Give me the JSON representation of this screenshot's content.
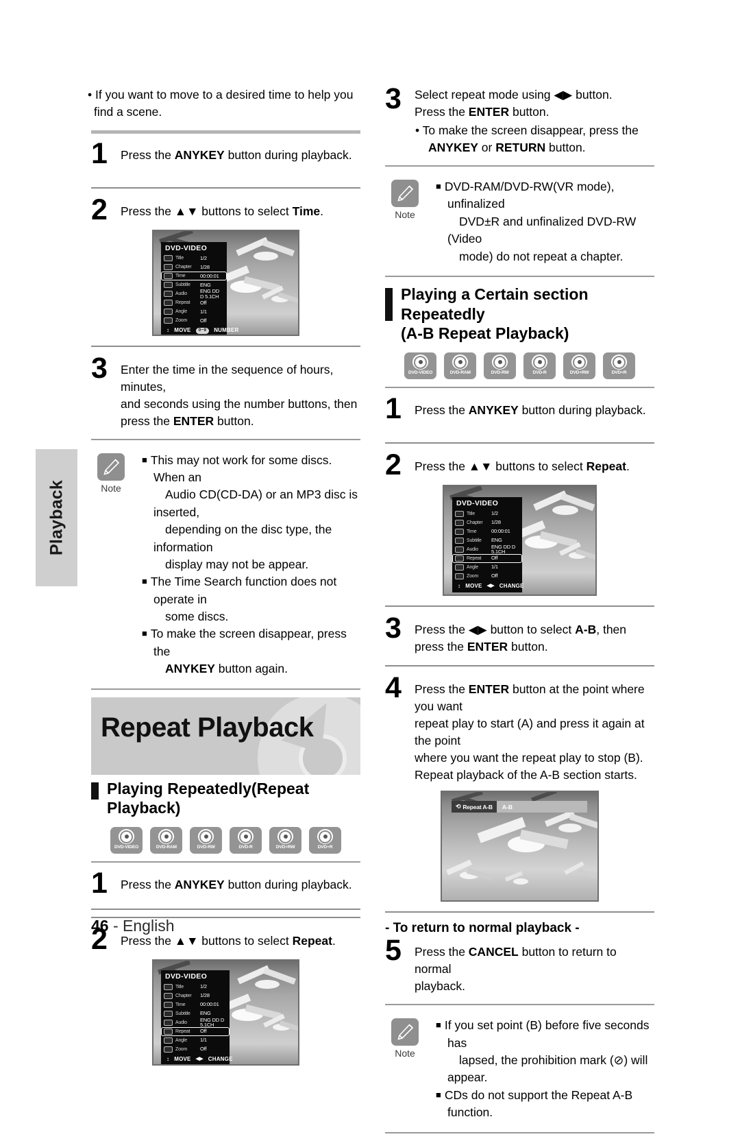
{
  "page": {
    "side_tab_label": "Playback",
    "footer_page_number": "46",
    "footer_separator": " - ",
    "footer_language": "English"
  },
  "icons": {
    "note_label": "Note",
    "note_icon": "pencil-icon",
    "disc_icon": "disc-icon",
    "repeat_icon": "repeat-icon"
  },
  "disc_badges": [
    {
      "label": "DVD-VIDEO"
    },
    {
      "label": "DVD-RAM"
    },
    {
      "label": "DVD-RW"
    },
    {
      "label": "DVD-R"
    },
    {
      "label": "DVD+RW"
    },
    {
      "label": "DVD+R"
    }
  ],
  "left_column": {
    "intro_bullet": "• If you want to move to a desired time to help you find a scene.",
    "time_search": {
      "step1_num": "1",
      "step1_text_pre": "Press the ",
      "step1_bold": "ANYKEY",
      "step1_text_post": " button during playback.",
      "step2_num": "2",
      "step2_text_pre": "Press the ▲▼ buttons to select ",
      "step2_bold": "Time",
      "step2_text_post": ".",
      "step3_num": "3",
      "step3_line1": "Enter the time in the sequence of hours, minutes,",
      "step3_line2": "and seconds using the number buttons, then",
      "step3_line3_pre": "press the ",
      "step3_bold": "ENTER",
      "step3_line3_post": " button."
    },
    "note_time_search": {
      "item1_line1": "This may not work for some discs. When an",
      "item1_line2": "Audio CD(CD-DA) or an MP3 disc is inserted,",
      "item1_line3": "depending on the disc type, the information",
      "item1_line4": "display may not be appear.",
      "item2_line1": "The Time Search function does not operate in",
      "item2_line2": "some discs.",
      "item3_line1": "To make the screen disappear, press the",
      "item3_bold": "ANYKEY",
      "item3_line2_post": " button again."
    },
    "banner_title": "Repeat Playback",
    "section_title": "Playing Repeatedly(Repeat Playback)",
    "repeat_playback": {
      "step1_num": "1",
      "step1_text_pre": "Press the ",
      "step1_bold": "ANYKEY",
      "step1_text_post": " button during playback.",
      "step2_num": "2",
      "step2_text_pre": "Press the ▲▼ buttons to select ",
      "step2_bold": "Repeat",
      "step2_text_post": "."
    }
  },
  "right_column": {
    "step3": {
      "num": "3",
      "line1_pre": "Select repeat mode using ◀▶ button.",
      "line2_pre": "Press the ",
      "line2_bold": "ENTER",
      "line2_post": " button.",
      "sub_line1": "• To make the screen disappear, press the",
      "sub_bold1": "ANYKEY",
      "sub_mid": " or ",
      "sub_bold2": "RETURN",
      "sub_post": " button."
    },
    "note_chapter": {
      "line1": "DVD-RAM/DVD-RW(VR mode), unfinalized",
      "line2": "DVD±R and unfinalized DVD-RW (Video",
      "line3": "mode) do not repeat a chapter."
    },
    "section_title_line1": "Playing a Certain section Repeatedly",
    "section_title_line2": "(A-B Repeat Playback)",
    "ab_repeat": {
      "step1_num": "1",
      "step1_text_pre": "Press the ",
      "step1_bold": "ANYKEY",
      "step1_text_post": " button during playback.",
      "step2_num": "2",
      "step2_text_pre": "Press the ▲▼ buttons to select ",
      "step2_bold": "Repeat",
      "step2_text_post": ".",
      "step3_num": "3",
      "step3_pre": "Press the ◀▶ button to select ",
      "step3_bold1": "A-B",
      "step3_mid": ", then press the ",
      "step3_bold2": "ENTER",
      "step3_post": " button.",
      "step4_num": "4",
      "step4_pre": "Press the ",
      "step4_bold": "ENTER",
      "step4_l1_post": " button at the point where you want",
      "step4_l2": "repeat play to start (A) and press it again at the point",
      "step4_l3": "where you want the repeat play to stop (B).",
      "step4_l4": "Repeat playback of the A-B section starts."
    },
    "return_heading": "- To return to normal playback -",
    "step5": {
      "num": "5",
      "pre": "Press the ",
      "bold": "CANCEL",
      "l1_post": " button to return to normal",
      "l2": "playback."
    },
    "note_ab": {
      "item1_line1": "If you set point (B) before five seconds has",
      "item1_line2": "lapsed, the prohibition mark (⊘) will appear.",
      "item2": "CDs do not support the Repeat A-B function."
    }
  },
  "osd": {
    "title": "DVD-VIDEO",
    "rows": [
      {
        "label": "Title",
        "value": "1/2"
      },
      {
        "label": "Chapter",
        "value": "1/28"
      },
      {
        "label": "Time",
        "value": "00:00:01"
      },
      {
        "label": "Subtitle",
        "value": "ENG"
      },
      {
        "label": "Audio",
        "value": "ENG DD D 5.1CH"
      },
      {
        "label": "Repeat",
        "value": "Off"
      },
      {
        "label": "Angle",
        "value": "1/1"
      },
      {
        "label": "Zoom",
        "value": "Off"
      }
    ],
    "foot_move": "MOVE",
    "foot_number_pill": "0~9",
    "foot_number": "NUMBER",
    "foot_change_arrows": "◀▶",
    "foot_change": "CHANGE",
    "foot_move_arrows": "↕"
  },
  "ab_overlay": {
    "label": "Repeat A-B",
    "value": "A-B"
  }
}
